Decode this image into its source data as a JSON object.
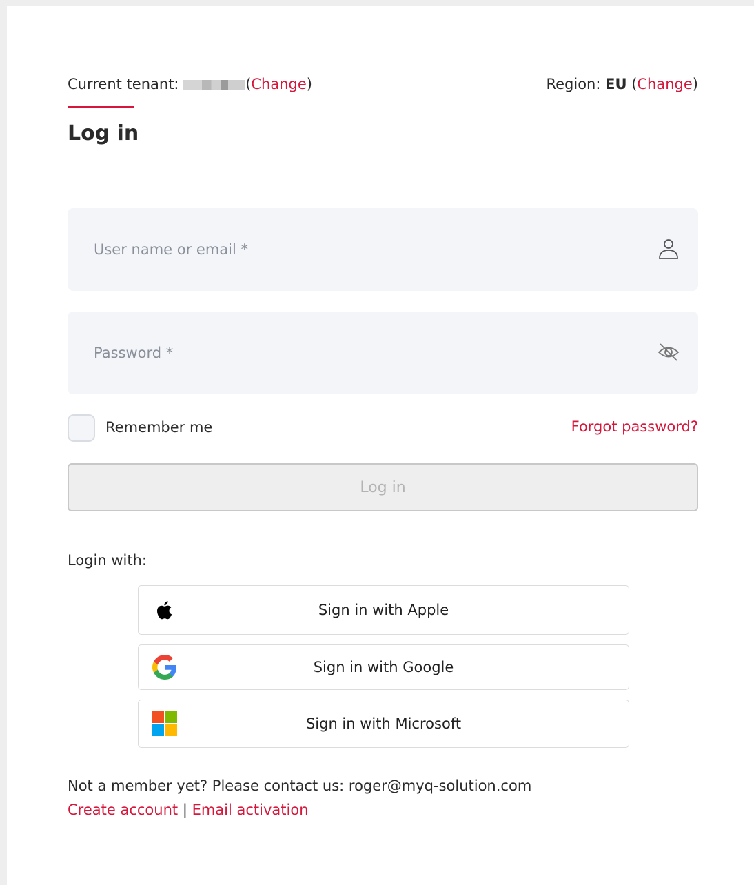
{
  "tenant": {
    "label": "Current tenant: ",
    "change_label": "Change"
  },
  "region": {
    "label": "Region: ",
    "value": "EU",
    "change_label": "Change"
  },
  "page": {
    "title": "Log in"
  },
  "form": {
    "username_placeholder": "User name or email *",
    "password_placeholder": "Password *",
    "remember_label": "Remember me",
    "forgot_label": "Forgot password?",
    "login_button_label": "Log in"
  },
  "sso": {
    "heading": "Login with:",
    "apple_label": "Sign in with Apple",
    "google_label": "Sign in with Google",
    "microsoft_label": "Sign in with Microsoft"
  },
  "footer": {
    "contact_text": "Not a member yet? Please contact us: roger@myq-solution.com",
    "create_account_label": "Create account",
    "separator": "|",
    "email_activation_label": "Email activation"
  },
  "colors": {
    "accent": "#d6173b",
    "field_background": "#f3f5f9",
    "disabled_button": "#eeeeee"
  }
}
